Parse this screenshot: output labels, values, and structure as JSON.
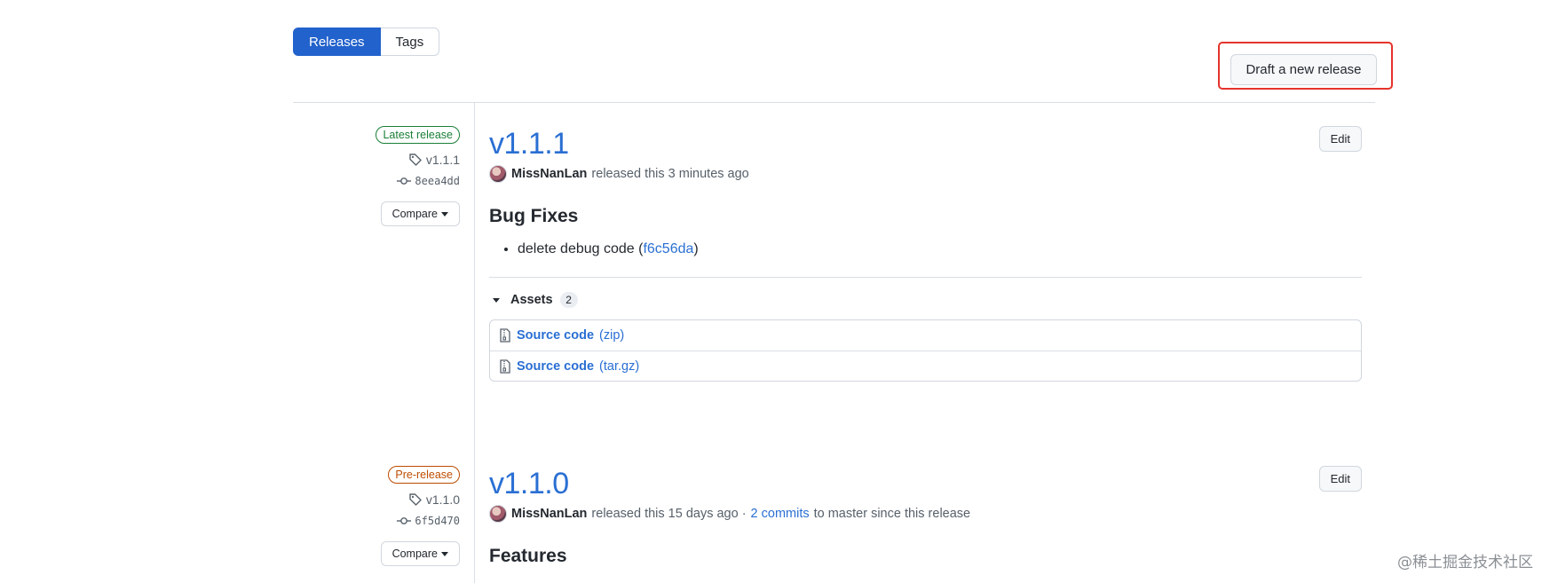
{
  "tabs": {
    "releases": "Releases",
    "tags": "Tags"
  },
  "draft_button": "Draft a new release",
  "releases": [
    {
      "badge": "Latest release",
      "tag": "v1.1.1",
      "commit": "8eea4dd",
      "compare": "Compare",
      "title": "v1.1.1",
      "edit": "Edit",
      "author": "MissNanLan",
      "released_text": "released this 3 minutes ago",
      "section": "Bug Fixes",
      "note_text": "delete debug code (",
      "note_link": "f6c56da",
      "note_close": ")",
      "assets_label": "Assets",
      "assets_count": "2",
      "assets": [
        {
          "name": "Source code",
          "ext": "(zip)"
        },
        {
          "name": "Source code",
          "ext": "(tar.gz)"
        }
      ]
    },
    {
      "badge": "Pre-release",
      "tag": "v1.1.0",
      "commit": "6f5d470",
      "compare": "Compare",
      "title": "v1.1.0",
      "edit": "Edit",
      "author": "MissNanLan",
      "released_text": "released this 15 days ago ·",
      "commits_link": "2 commits",
      "commits_suffix": "to master since this release",
      "section": "Features"
    }
  ],
  "watermark": "@稀土掘金技术社区",
  "colors": {
    "accent": "#2262cc",
    "link": "#2a6fd3",
    "latest": "#1a7f37",
    "prerelease": "#bc4c00",
    "highlight": "#e5332a"
  }
}
